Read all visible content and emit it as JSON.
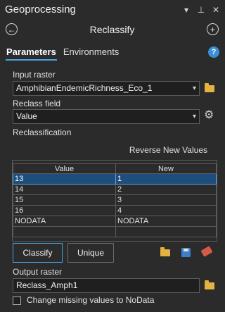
{
  "window": {
    "title": "Geoprocessing",
    "icons": [
      "chevron-down-icon",
      "pin-icon",
      "close-icon"
    ]
  },
  "nav": {
    "tool_title": "Reclassify",
    "back_icon": "back-arrow-icon",
    "add_icon": "add-icon"
  },
  "tabs": [
    {
      "label": "Parameters",
      "active": true
    },
    {
      "label": "Environments",
      "active": false
    }
  ],
  "help": {
    "icon": "help-icon",
    "glyph": "?"
  },
  "params": {
    "input_raster_label": "Input raster",
    "input_raster_value": "AmphibianEndemicRichness_Eco_1",
    "reclass_field_label": "Reclass field",
    "reclass_field_value": "Value",
    "reclassification_label": "Reclassification",
    "reverse_new_values": "Reverse New Values"
  },
  "table": {
    "columns": [
      "Value",
      "New"
    ],
    "rows": [
      {
        "value": "13",
        "new": "1",
        "selected": true
      },
      {
        "value": "14",
        "new": "2",
        "selected": false
      },
      {
        "value": "15",
        "new": "3",
        "selected": false
      },
      {
        "value": "16",
        "new": "4",
        "selected": false
      },
      {
        "value": "NODATA",
        "new": "NODATA",
        "selected": false
      },
      {
        "value": "",
        "new": "",
        "selected": false
      }
    ]
  },
  "buttons": {
    "classify": "Classify",
    "unique": "Unique"
  },
  "output": {
    "label": "Output raster",
    "value": "Reclass_Amph1"
  },
  "option": {
    "label": "Change missing values to NoData",
    "checked": false
  },
  "colors": {
    "background": "#2b2b2b",
    "accent": "#4aa3e0",
    "selection": "#1e4e7c",
    "folder": "#e3b341"
  }
}
